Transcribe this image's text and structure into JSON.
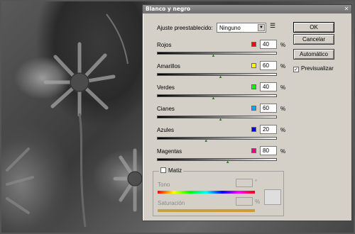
{
  "dialog": {
    "title": "Blanco y negro",
    "preset": {
      "label": "Ajuste preestablecido:",
      "value": "Ninguno"
    },
    "sliders": [
      {
        "label": "Rojos",
        "value": "40",
        "unit": "%",
        "color": "#ff0000",
        "position_fraction": 0.47
      },
      {
        "label": "Amarillos",
        "value": "60",
        "unit": "%",
        "color": "#ffff00",
        "position_fraction": 0.53
      },
      {
        "label": "Verdes",
        "value": "40",
        "unit": "%",
        "color": "#00ff00",
        "position_fraction": 0.47
      },
      {
        "label": "Cianes",
        "value": "60",
        "unit": "%",
        "color": "#00aaee",
        "position_fraction": 0.53
      },
      {
        "label": "Azules",
        "value": "20",
        "unit": "%",
        "color": "#0000dd",
        "position_fraction": 0.41
      },
      {
        "label": "Magentas",
        "value": "80",
        "unit": "%",
        "color": "#ee0088",
        "position_fraction": 0.59
      }
    ],
    "buttons": {
      "ok": "OK",
      "cancel": "Cancelar",
      "auto": "Automático"
    },
    "preview": {
      "label": "Previsualizar",
      "checked": true
    },
    "tint": {
      "title": "Matiz",
      "checked": false,
      "hue_label": "Tono",
      "hue_unit": "°",
      "saturation_label": "Saturación",
      "saturation_unit": "%"
    }
  }
}
